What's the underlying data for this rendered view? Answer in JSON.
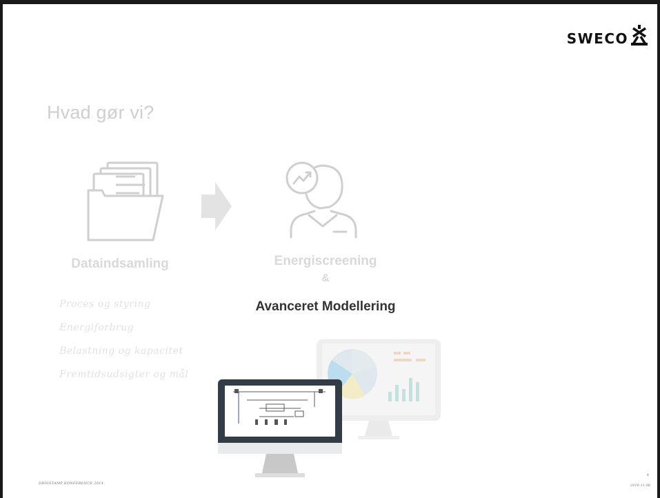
{
  "brand": {
    "name": "SWECO"
  },
  "slide": {
    "title": "Hvad gør vi?",
    "step1": {
      "label": "Dataindsamling",
      "icon": "folder-documents-icon"
    },
    "step2": {
      "label": "Energiscreening",
      "connector": "&",
      "highlight": "Avanceret Modellering",
      "icon": "person-analytics-icon"
    },
    "bullets": [
      "Proces og styring",
      "Energiforbrug",
      "Belastning og kapacitet",
      "Fremtidsudsigter og mål"
    ],
    "colors": {
      "faded_text": "#d9d9d9",
      "highlight_text": "#333333",
      "monitor_frame": "#333d47",
      "monitor_stand": "#cccccc",
      "chart_accent": "#8fcfc9"
    }
  },
  "footer": {
    "left": "DRIGSTAMP KONFERENCE 2014",
    "page": "4",
    "date": "2016-11-06"
  }
}
